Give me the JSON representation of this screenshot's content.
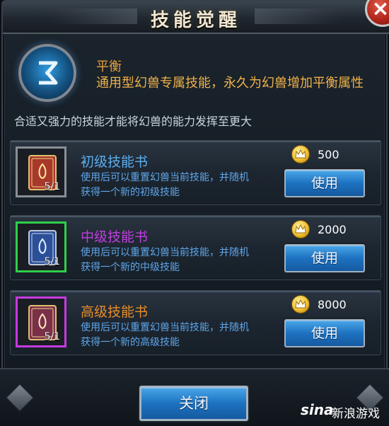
{
  "dialog": {
    "title": "技能觉醒",
    "close_symbol": "×"
  },
  "skill": {
    "icon": "balance-skill-icon",
    "name": "平衡",
    "description": "通用型幻兽专属技能，永久为幻兽增加平衡属性",
    "tip": "合适又强力的技能才能将幻兽的能力发挥至更大"
  },
  "books": [
    {
      "name": "初级技能书",
      "name_color": "#5aaef0",
      "frame_color": "#8a8f96",
      "book_color": "#a8382a",
      "count": "5/1",
      "desc_line1": "使用后可以重置幻兽当前技能，并随机",
      "desc_line2": "获得一个新的初级技能",
      "price": "500",
      "button": "使用"
    },
    {
      "name": "中级技能书",
      "name_color": "#c13ee0",
      "frame_color": "#2fcf4a",
      "book_color": "#2c4f9a",
      "count": "5/1",
      "desc_line1": "使用后可以重置幻兽当前技能，并随机",
      "desc_line2": "获得一个新的中级技能",
      "price": "2000",
      "button": "使用"
    },
    {
      "name": "高级技能书",
      "name_color": "#e88d2a",
      "frame_color": "#c63be0",
      "book_color": "#7a3048",
      "count": "5/1",
      "desc_line1": "使用后可以重置幻兽当前技能，并随机",
      "desc_line2": "获得一个新的高级技能",
      "price": "8000",
      "button": "使用"
    }
  ],
  "footer": {
    "close_button": "关闭"
  },
  "watermark": {
    "logo": "sina",
    "text": "新浪游戏"
  }
}
